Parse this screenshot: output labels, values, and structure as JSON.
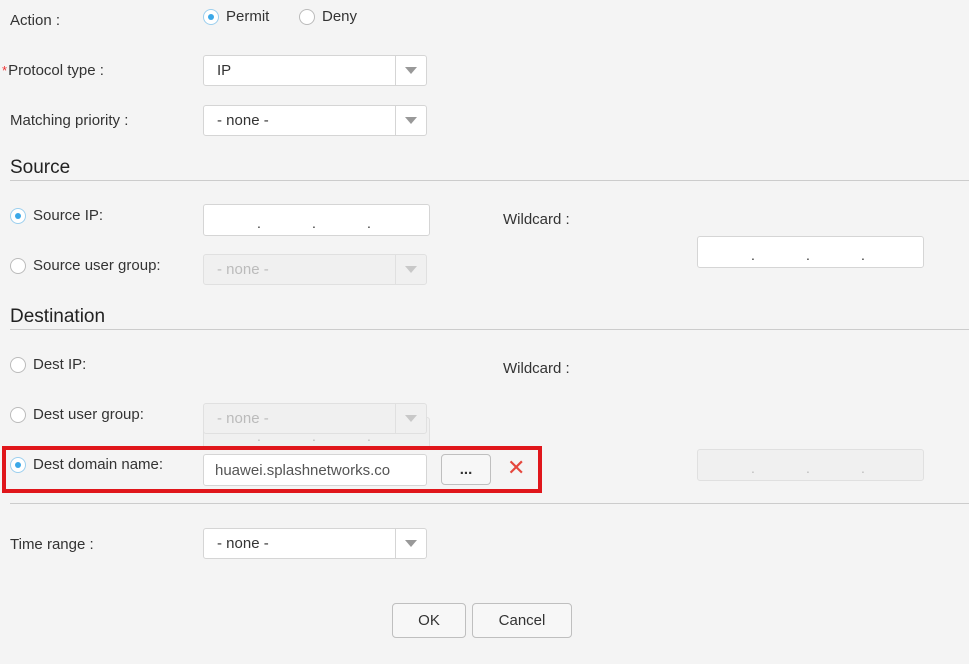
{
  "action": {
    "label": "Action :",
    "permit_label": "Permit",
    "deny_label": "Deny",
    "selected": "Permit"
  },
  "protocol": {
    "required_mark": "*",
    "label": "Protocol type :",
    "value": "IP"
  },
  "matching_priority": {
    "label": "Matching priority :",
    "value": "- none -"
  },
  "source": {
    "title": "Source",
    "ip_label": "Source IP:",
    "wildcard_label": "Wildcard :",
    "user_group_label": "Source user group:",
    "user_group_value": "- none -"
  },
  "destination": {
    "title": "Destination",
    "ip_label": "Dest IP:",
    "wildcard_label": "Wildcard :",
    "user_group_label": "Dest user group:",
    "user_group_value": "- none -",
    "domain_label": "Dest domain name:",
    "domain_value": "huawei.splashnetworks.co",
    "browse_label": "...",
    "highlight_color": "#e0161b"
  },
  "time_range": {
    "label": "Time range :",
    "value": "- none -"
  },
  "footer": {
    "ok_label": "OK",
    "cancel_label": "Cancel"
  },
  "ip_separator": ".",
  "colors": {
    "radio_selected": "#3ba8e8",
    "required": "#e33333",
    "clear_icon": "#e5473d"
  }
}
